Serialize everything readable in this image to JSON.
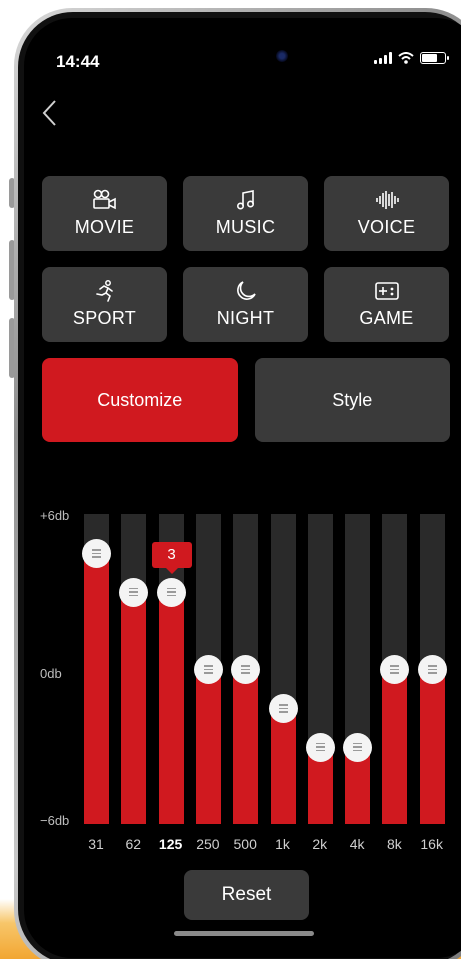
{
  "status_bar": {
    "time": "14:44"
  },
  "modes": [
    {
      "label": "MOVIE",
      "icon": "movie-camera-icon"
    },
    {
      "label": "MUSIC",
      "icon": "music-note-icon"
    },
    {
      "label": "VOICE",
      "icon": "voice-wave-icon"
    },
    {
      "label": "SPORT",
      "icon": "running-person-icon"
    },
    {
      "label": "NIGHT",
      "icon": "moon-icon"
    },
    {
      "label": "GAME",
      "icon": "gamepad-icon"
    }
  ],
  "tabs": {
    "customize": "Customize",
    "style": "Style"
  },
  "colors": {
    "accent": "#d0191f",
    "button_bg": "#3a3a3a",
    "track_bg": "#2a2a2a"
  },
  "equalizer": {
    "scale": {
      "top": "+6db",
      "middle": "0db",
      "bottom": "−6db"
    },
    "bands": [
      {
        "freq": "31",
        "gain": 4.5
      },
      {
        "freq": "62",
        "gain": 3
      },
      {
        "freq": "125",
        "gain": 3,
        "selected": true
      },
      {
        "freq": "250",
        "gain": 0
      },
      {
        "freq": "500",
        "gain": 0
      },
      {
        "freq": "1k",
        "gain": -1.5
      },
      {
        "freq": "2k",
        "gain": -3
      },
      {
        "freq": "4k",
        "gain": -3
      },
      {
        "freq": "8k",
        "gain": 0
      },
      {
        "freq": "16k",
        "gain": 0
      }
    ],
    "selected_value": "3"
  },
  "reset_label": "Reset"
}
